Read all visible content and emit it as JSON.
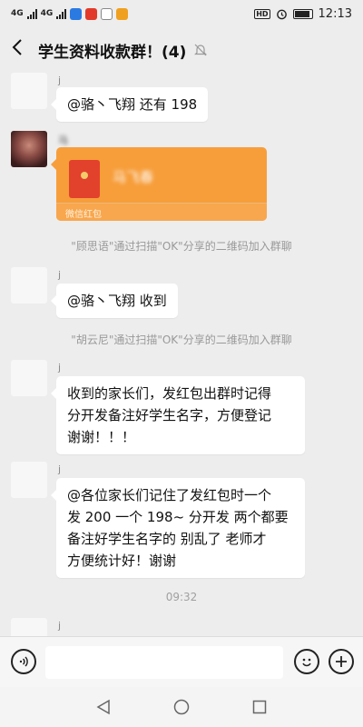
{
  "status_bar": {
    "signal_1": "4G",
    "signal_2": "4G",
    "time": "12:13",
    "hd_label": "HD"
  },
  "header": {
    "title": "学生资料收款群！(4)"
  },
  "messages": {
    "m1": {
      "nick": "j",
      "text": "@骆丶飞翔  还有 198"
    },
    "m2": {
      "nick": "马",
      "redpacket_title": "马飞春",
      "redpacket_footer": "微信红包"
    },
    "sys1": "\"顾思语\"通过扫描\"OK\"分享的二维码加入群聊",
    "m3": {
      "nick": "j",
      "text": "@骆丶飞翔  收到"
    },
    "sys2": "\"胡云尼\"通过扫描\"OK\"分享的二维码加入群聊",
    "m4": {
      "nick": "j",
      "line1": "收到的家长们，发红包出群时记得",
      "line2": "分开发备注好学生名字，方便登记",
      "line3": " 谢谢！！！"
    },
    "m5": {
      "nick": "j",
      "line1": "@各位家长们记住了发红包时一个",
      "line2": "发 200 一个 198~ 分开发 两个都要",
      "line3": "备注好学生名字的 别乱了 老师才",
      "line4": "方便统计好！谢谢"
    },
    "time1": "09:32",
    "m6": {
      "nick": "j"
    }
  },
  "colors": {
    "redpacket": "#f79e3b",
    "background": "#ededed"
  }
}
